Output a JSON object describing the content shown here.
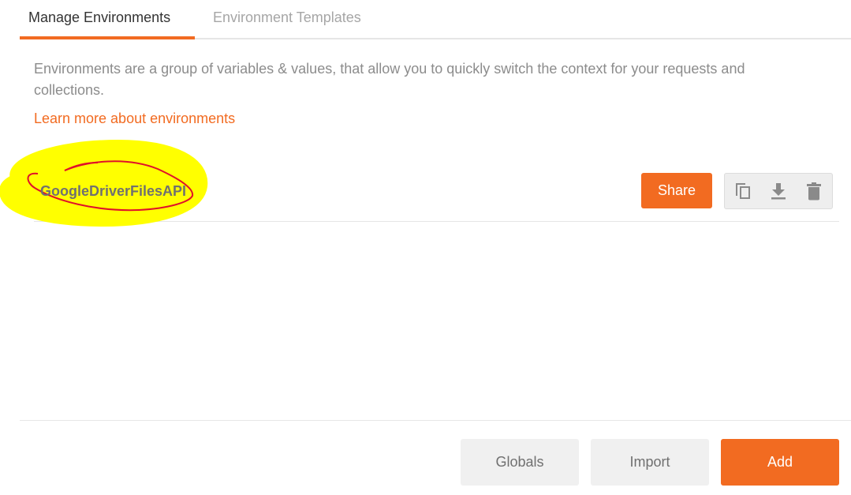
{
  "tabs": {
    "manage": "Manage Environments",
    "templates": "Environment Templates",
    "active": "manage"
  },
  "description": "Environments are a group of variables & values, that allow you to quickly switch the context for your requests and collections.",
  "learn_more_link": "Learn more about environments",
  "environments": [
    {
      "name": "GoogleDriverFilesAPI",
      "share_label": "Share",
      "actions": [
        "duplicate-icon",
        "download-icon",
        "trash-icon"
      ]
    }
  ],
  "footer": {
    "globals_label": "Globals",
    "import_label": "Import",
    "add_label": "Add"
  },
  "colors": {
    "accent": "#f26b21",
    "annotation_highlight": "#ffff00",
    "annotation_pen": "#e0102a"
  }
}
